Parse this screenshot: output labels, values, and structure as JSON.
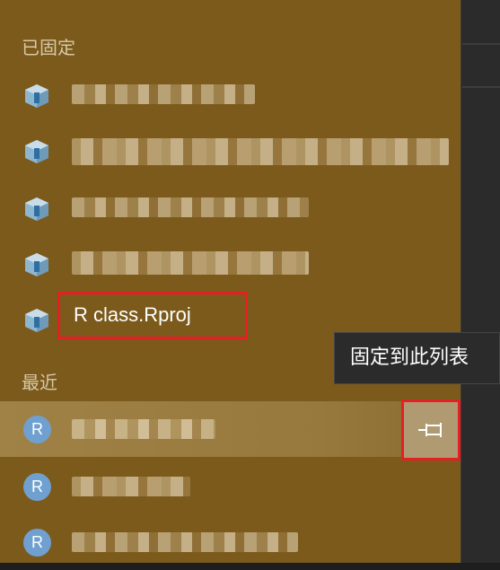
{
  "pinned": {
    "header": "已固定",
    "items": [
      {
        "label": "",
        "blurred": true
      },
      {
        "label": "",
        "blurred": true
      },
      {
        "label": "",
        "blurred": true
      },
      {
        "label": "",
        "blurred": true
      },
      {
        "label": "R class.Rproj",
        "blurred": false
      }
    ]
  },
  "recent": {
    "header": "最近",
    "items": [
      {
        "icon_text": "R",
        "blurred": true
      },
      {
        "icon_text": "R",
        "blurred": true
      },
      {
        "icon_text": "R",
        "blurred": true
      }
    ]
  },
  "tooltip": {
    "text": "固定到此列表"
  },
  "pin_button": {
    "icon": "pin-icon"
  },
  "colors": {
    "panel": "#7b5a1c",
    "highlight_border": "#e81e25",
    "r_icon": "#6fa0cf",
    "tooltip_bg": "#2b2b2b"
  }
}
